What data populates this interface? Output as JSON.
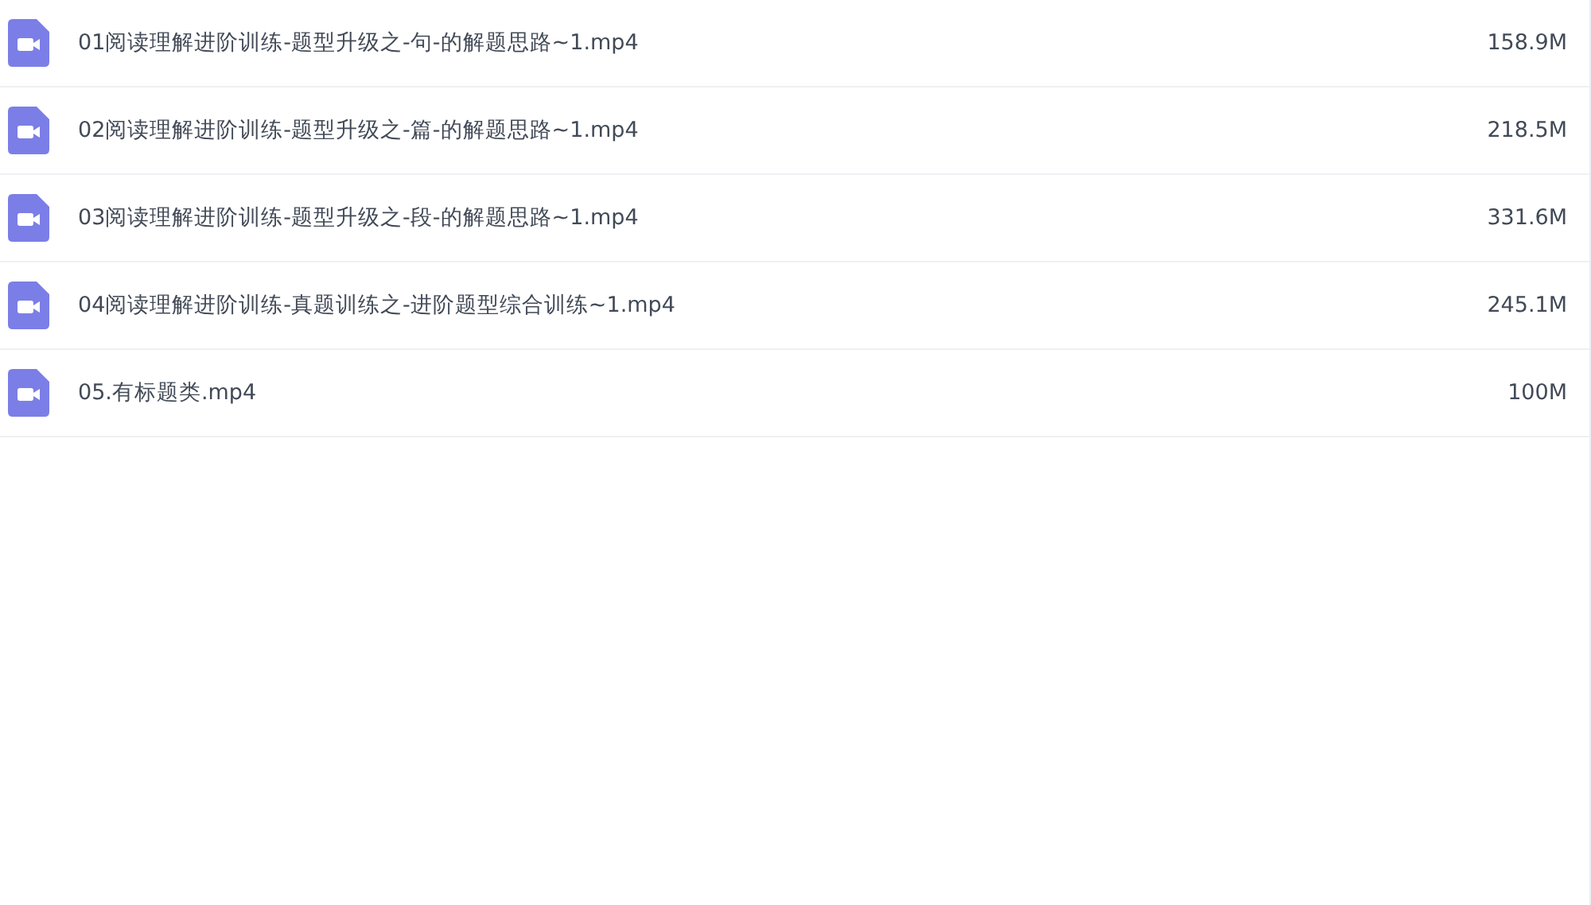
{
  "files": [
    {
      "kind": "video",
      "name": "01阅读理解进阶训练-题型升级之-句-的解题思路~1.mp4",
      "size": "158.9M"
    },
    {
      "kind": "video",
      "name": "02阅读理解进阶训练-题型升级之-篇-的解题思路~1.mp4",
      "size": "218.5M"
    },
    {
      "kind": "video",
      "name": "03阅读理解进阶训练-题型升级之-段-的解题思路~1.mp4",
      "size": "331.6M"
    },
    {
      "kind": "video",
      "name": "04阅读理解进阶训练-真题训练之-进阶题型综合训练~1.mp4",
      "size": "245.1M"
    },
    {
      "kind": "video",
      "name": "05.有标题类.mp4",
      "size": "100M"
    }
  ]
}
